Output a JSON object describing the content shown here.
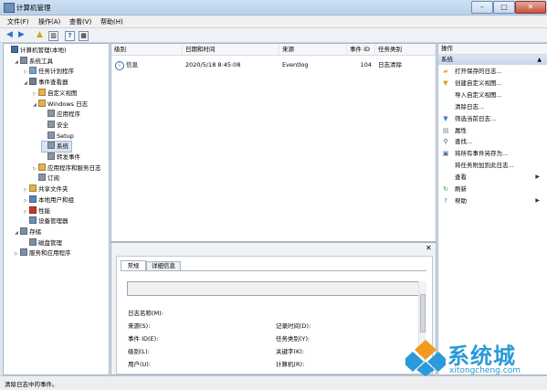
{
  "window": {
    "title": "计算机管理"
  },
  "menu": [
    "文件(F)",
    "操作(A)",
    "查看(V)",
    "帮助(H)"
  ],
  "tree": [
    {
      "label": "计算机管理(本地)",
      "level": 0,
      "twisty": "",
      "icon": "computer-icon",
      "color": "#4a6f9c"
    },
    {
      "label": "系统工具",
      "level": 1,
      "twisty": "◢",
      "icon": "tools-icon",
      "color": "#7d8fa3"
    },
    {
      "label": "任务计划程序",
      "level": 2,
      "twisty": "▷",
      "icon": "clock-icon",
      "color": "#7aa0c4"
    },
    {
      "label": "事件查看器",
      "level": 2,
      "twisty": "◢",
      "icon": "event-viewer-icon",
      "color": "#6f7f94"
    },
    {
      "label": "自定义视图",
      "level": 3,
      "twisty": "▷",
      "icon": "folder-icon",
      "color": "#e3b04b"
    },
    {
      "label": "Windows 日志",
      "level": 3,
      "twisty": "◢",
      "icon": "folder-icon",
      "color": "#e3b04b"
    },
    {
      "label": "应用程序",
      "level": 4,
      "twisty": "",
      "icon": "log-icon",
      "color": "#8a96a6"
    },
    {
      "label": "安全",
      "level": 4,
      "twisty": "",
      "icon": "log-icon",
      "color": "#8a96a6"
    },
    {
      "label": "Setup",
      "level": 4,
      "twisty": "",
      "icon": "log-icon",
      "color": "#8a96a6"
    },
    {
      "label": "系统",
      "level": 4,
      "twisty": "",
      "icon": "log-icon",
      "color": "#8a96a6",
      "selected": true
    },
    {
      "label": "转发事件",
      "level": 4,
      "twisty": "",
      "icon": "log-icon",
      "color": "#8a96a6"
    },
    {
      "label": "应用程序和服务日志",
      "level": 3,
      "twisty": "▷",
      "icon": "folder-icon",
      "color": "#e3b04b"
    },
    {
      "label": "订阅",
      "level": 3,
      "twisty": "",
      "icon": "subscription-icon",
      "color": "#8a96a6"
    },
    {
      "label": "共享文件夹",
      "level": 2,
      "twisty": "▷",
      "icon": "shared-folder-icon",
      "color": "#e3b04b"
    },
    {
      "label": "本地用户和组",
      "level": 2,
      "twisty": "▷",
      "icon": "users-icon",
      "color": "#5b86b8"
    },
    {
      "label": "性能",
      "level": 2,
      "twisty": "▷",
      "icon": "performance-icon",
      "color": "#c0392b"
    },
    {
      "label": "设备管理器",
      "level": 2,
      "twisty": "",
      "icon": "device-manager-icon",
      "color": "#6a8caf"
    },
    {
      "label": "存储",
      "level": 1,
      "twisty": "◢",
      "icon": "storage-icon",
      "color": "#7d8fa3"
    },
    {
      "label": "磁盘管理",
      "level": 2,
      "twisty": "",
      "icon": "disk-icon",
      "color": "#7d8fa3"
    },
    {
      "label": "服务和应用程序",
      "level": 1,
      "twisty": "▷",
      "icon": "services-icon",
      "color": "#7d8fa3"
    }
  ],
  "event_table": {
    "headers": [
      "级别",
      "日期和时间",
      "来源",
      "事件 ID",
      "任务类别"
    ],
    "rows": [
      {
        "level": "信息",
        "datetime": "2020/5/18 8:45:08",
        "source": "Eventlog",
        "event_id": "104",
        "category": "日志清除"
      }
    ]
  },
  "detail": {
    "tabs": [
      "常规",
      "详细信息"
    ],
    "fields_left": [
      "日志名称(M):",
      "来源(S):",
      "事件 ID(E):",
      "级别(L):",
      "用户(U):"
    ],
    "fields_right": [
      "记录时间(D):",
      "任务类别(Y):",
      "关键字(K):",
      "计算机(R):"
    ]
  },
  "actions": {
    "title": "操作",
    "section": "系统",
    "items": [
      {
        "label": "打开保存的日志...",
        "icon": "open-folder-icon",
        "glyph": "▰",
        "color": "#e3b04b"
      },
      {
        "label": "创建自定义视图...",
        "icon": "filter-icon",
        "glyph": "▼",
        "color": "#d4a017"
      },
      {
        "label": "导入自定义视图...",
        "icon": "",
        "glyph": "",
        "color": ""
      },
      {
        "label": "清除日志...",
        "icon": "",
        "glyph": "",
        "color": ""
      },
      {
        "label": "筛选当前日志...",
        "icon": "filter-icon",
        "glyph": "▼",
        "color": "#3a7bd5"
      },
      {
        "label": "属性",
        "icon": "properties-icon",
        "glyph": "▤",
        "color": "#6a7f96"
      },
      {
        "label": "查找...",
        "icon": "find-icon",
        "glyph": "⚲",
        "color": "#3b5b8c"
      },
      {
        "label": "将所有事件另存为...",
        "icon": "save-icon",
        "glyph": "▣",
        "color": "#4a6f9c"
      },
      {
        "label": "将任务附加到此日志...",
        "icon": "",
        "glyph": "",
        "color": ""
      },
      {
        "label": "查看",
        "icon": "",
        "glyph": "",
        "color": "",
        "submenu": true
      },
      {
        "label": "刷新",
        "icon": "refresh-icon",
        "glyph": "↻",
        "color": "#2e9b3e"
      },
      {
        "label": "帮助",
        "icon": "help-icon",
        "glyph": "?",
        "color": "#3a6fb5",
        "submenu": true
      }
    ]
  },
  "status": "清除日志中的事件。",
  "watermark": {
    "brand": "系统城",
    "url": "xitongcheng.com"
  }
}
